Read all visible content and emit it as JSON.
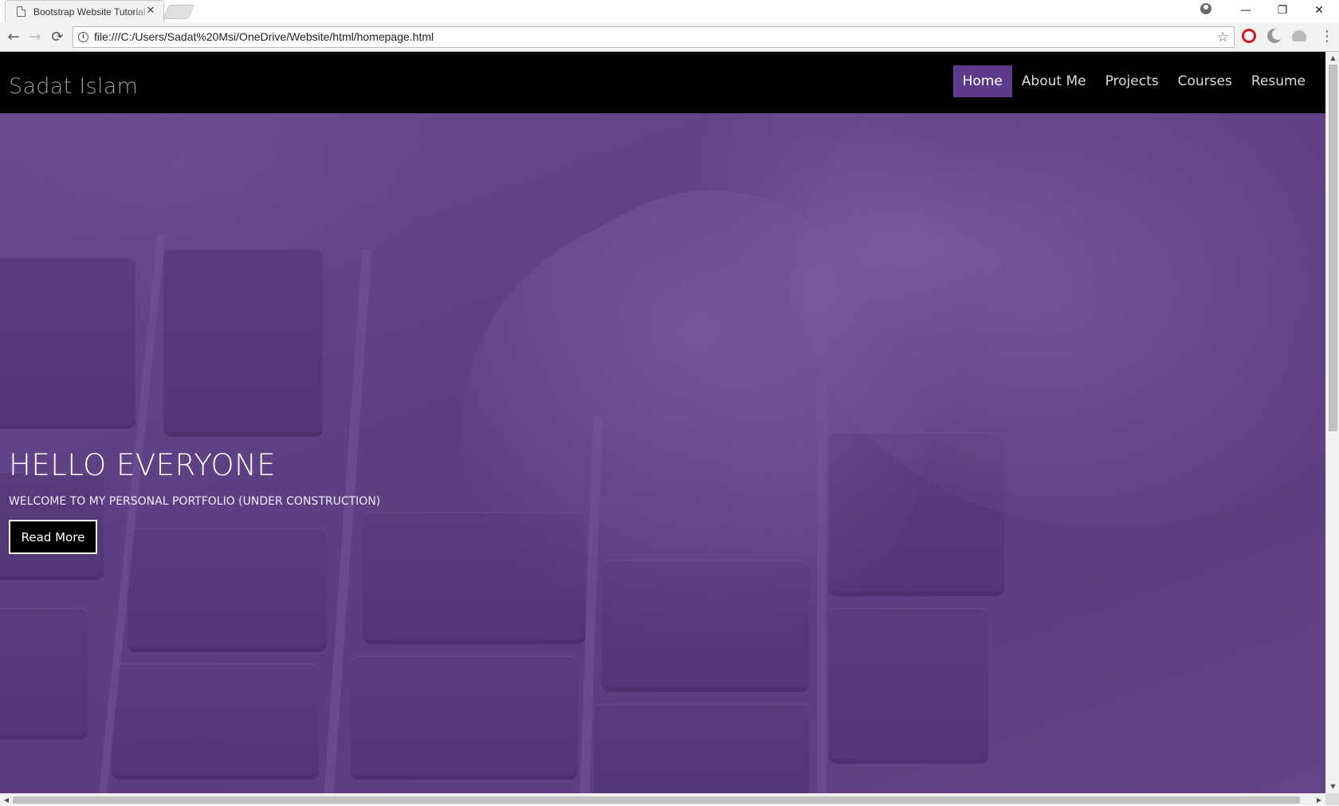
{
  "browser": {
    "tab_title": "Bootstrap Website Tutorial",
    "tab_close": "✕",
    "url": "file:///C:/Users/Sadat%20Msi/OneDrive/Website/html/homepage.html",
    "icons": {
      "back": "←",
      "forward": "→",
      "reload": "⟳",
      "info": "i",
      "star": "☆",
      "menu": "⋮",
      "minimize": "—",
      "restore": "❐",
      "close": "✕"
    }
  },
  "page": {
    "brand": "Sadat Islam",
    "nav": [
      {
        "label": "Home",
        "active": true
      },
      {
        "label": "About Me"
      },
      {
        "label": "Projects"
      },
      {
        "label": "Courses"
      },
      {
        "label": "Resume"
      }
    ],
    "hero": {
      "title": "HELLO EVERYONE",
      "subtitle": "WELCOME TO MY PERSONAL PORTFOLIO (UNDER CONSTRUCTION)",
      "button": "Read More"
    },
    "colors": {
      "navbar_bg": "#000000",
      "active_nav_bg": "#5d3a8a",
      "hero_tint": "#5a3d7c"
    }
  }
}
